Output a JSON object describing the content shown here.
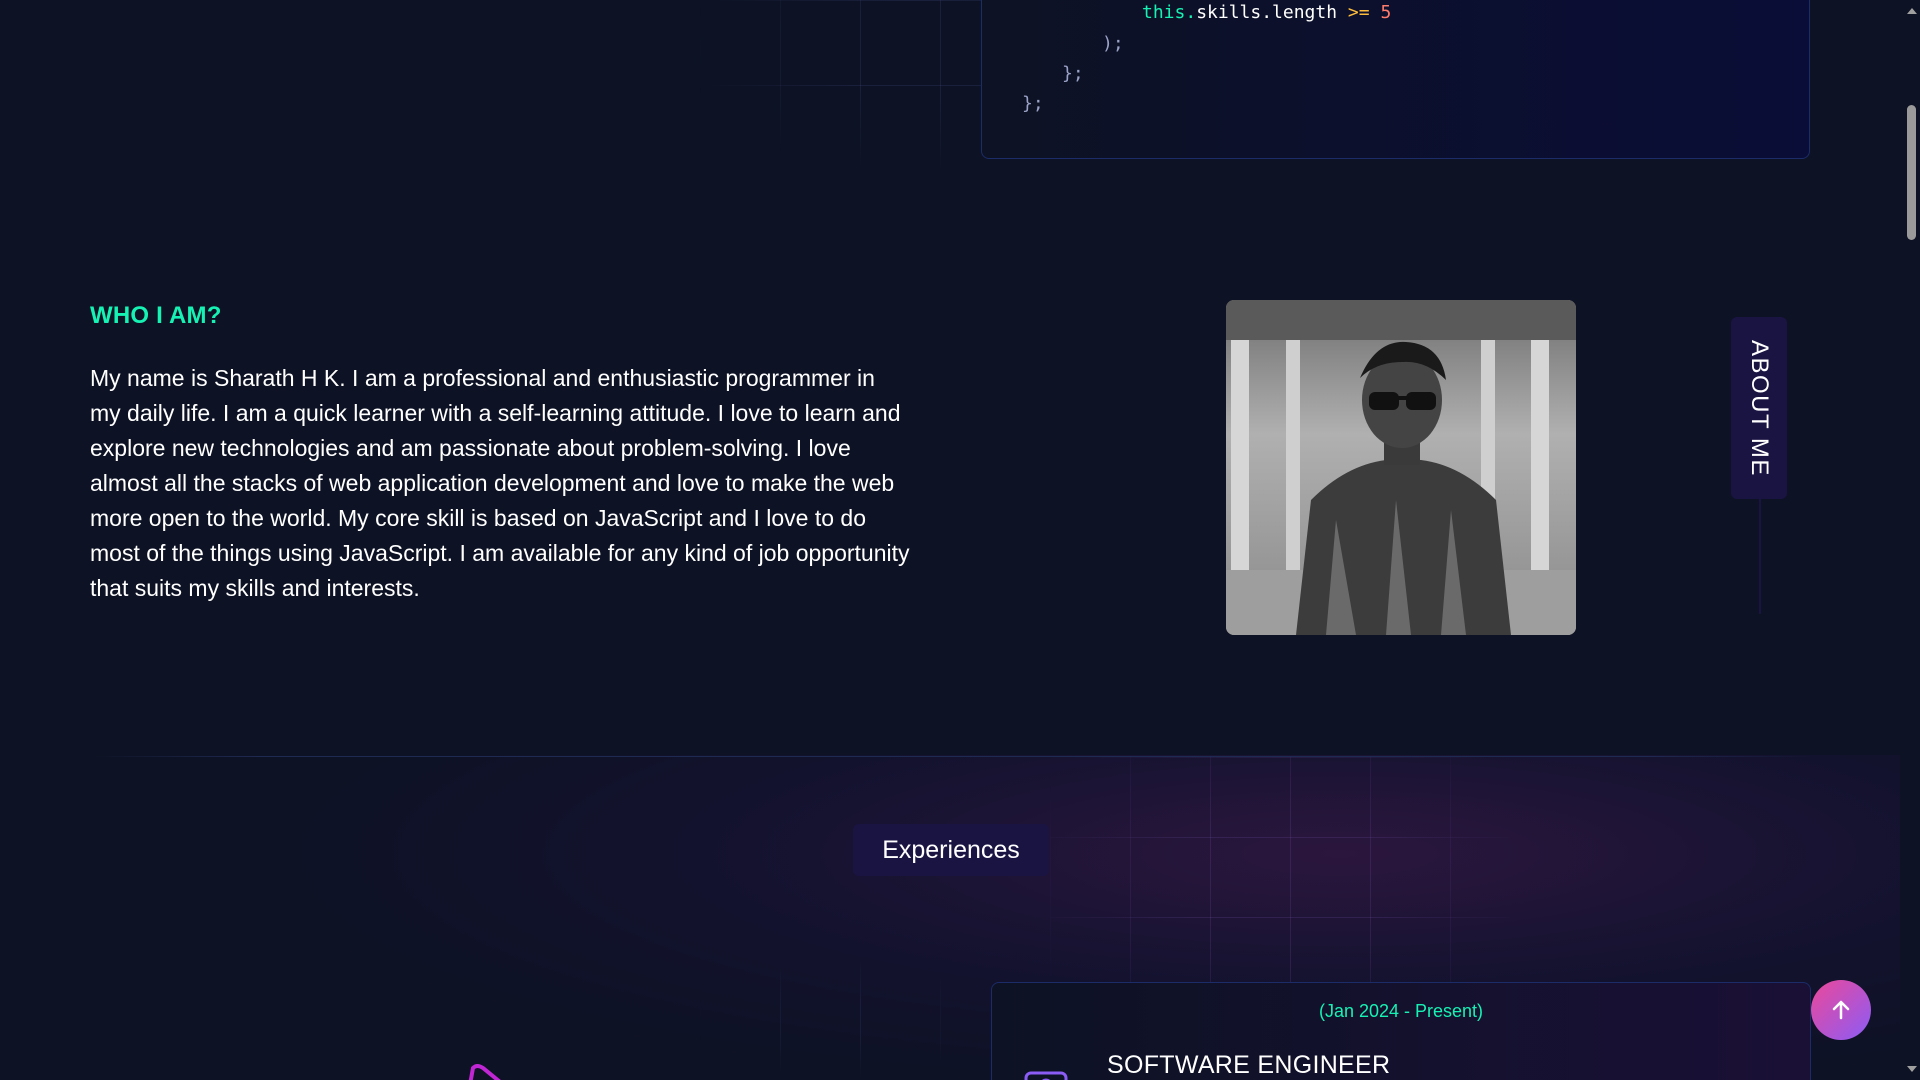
{
  "code": {
    "line1": {
      "this": "this.",
      "prop": "skills.length",
      "op": " >= ",
      "num": "5"
    },
    "line2": ");",
    "line3": "};",
    "line4": "};"
  },
  "about": {
    "heading": "WHO I AM?",
    "paragraph": "My name is Sharath H K. I am a professional and enthusiastic programmer in my daily life. I am a quick learner with a self-learning attitude. I love to learn and explore new technologies and am passionate about problem-solving. I love almost all the stacks of web application development and love to make the web more open to the world. My core skill is based on JavaScript and I love to do most of the things using JavaScript. I am available for any kind of job opportunity that suits my skills and interests.",
    "side_tab": "ABOUT ME"
  },
  "experiences": {
    "title": "Experiences",
    "items": [
      {
        "date": "(Jan 2024 - Present)",
        "role": "SOFTWARE ENGINEER"
      }
    ]
  },
  "colors": {
    "accent": "#16f2b3",
    "background": "#0d1224",
    "pill": "#1a1443",
    "scroll_button_from": "#ec4899",
    "scroll_button_to": "#8b5cf6"
  },
  "icons": {
    "scroll_top": "arrow-up-icon",
    "experience": "briefcase-icon"
  }
}
